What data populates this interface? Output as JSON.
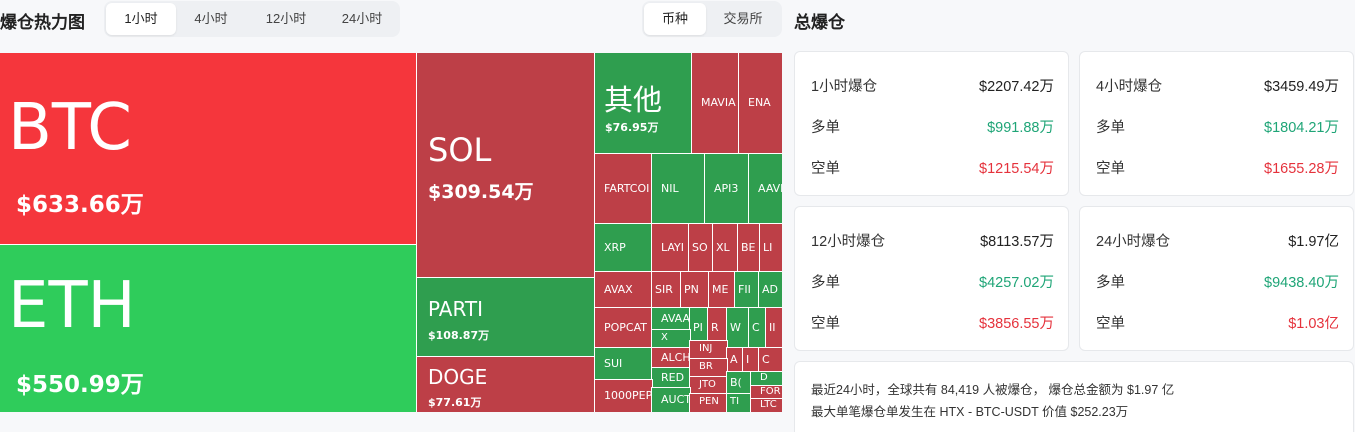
{
  "heatmap_title": "爆仓热力图",
  "time_tabs": [
    "1小时",
    "4小时",
    "12小时",
    "24小时"
  ],
  "active_time_tab": "1小时",
  "view_tabs": [
    "币种",
    "交易所"
  ],
  "active_view_tab": "币种",
  "colors": {
    "bright_red": "#f5363c",
    "bright_green": "#2fcc5b",
    "dark_red": "#bd3f47",
    "dark_green": "#2f9e4f"
  },
  "treemap": {
    "btc": {
      "symbol": "BTC",
      "value": "$633.66万"
    },
    "eth": {
      "symbol": "ETH",
      "value": "$550.99万"
    },
    "sol": {
      "symbol": "SOL",
      "value": "$309.54万"
    },
    "parti": {
      "symbol": "PARTI",
      "value": "$108.87万"
    },
    "doge": {
      "symbol": "DOGE",
      "value": "$77.61万"
    },
    "other": {
      "symbol": "其他",
      "value": "$76.95万"
    },
    "small": [
      "MAVIA",
      "ENA",
      "FARTCOI",
      "NIL",
      "API3",
      "AAVE",
      "XRP",
      "LAYI",
      "SO",
      "XL",
      "BE",
      "LI",
      "AVAX",
      "SIR",
      "PN",
      "ME",
      "FII",
      "AD",
      "POPCAT",
      "AVAA",
      "PI",
      "R",
      "W",
      "C",
      "II",
      "X",
      "SUI",
      "ALCH",
      "INJ",
      "A",
      "I",
      "C",
      "RED",
      "BR",
      "JTO",
      "B(",
      "D",
      "1000PEP",
      "AUCT",
      "PEN",
      "TI",
      "FOR",
      "LTC"
    ]
  },
  "summary_title": "总爆仓",
  "cards": [
    {
      "period": "1小时爆仓",
      "total": "$2207.42万",
      "long_label": "多单",
      "long": "$991.88万",
      "short_label": "空单",
      "short": "$1215.54万"
    },
    {
      "period": "4小时爆仓",
      "total": "$3459.49万",
      "long_label": "多单",
      "long": "$1804.21万",
      "short_label": "空单",
      "short": "$1655.28万"
    },
    {
      "period": "12小时爆仓",
      "total": "$8113.57万",
      "long_label": "多单",
      "long": "$4257.02万",
      "short_label": "空单",
      "short": "$3856.55万"
    },
    {
      "period": "24小时爆仓",
      "total": "$1.97亿",
      "long_label": "多单",
      "long": "$9438.40万",
      "short_label": "空单",
      "short": "$1.03亿"
    }
  ],
  "footer_line1": "最近24小时，全球共有 84,419 人被爆仓， 爆仓总金额为 $1.97 亿",
  "footer_line2": "最大单笔爆仓单发生在 HTX - BTC-USDT 价值 $252.23万"
}
